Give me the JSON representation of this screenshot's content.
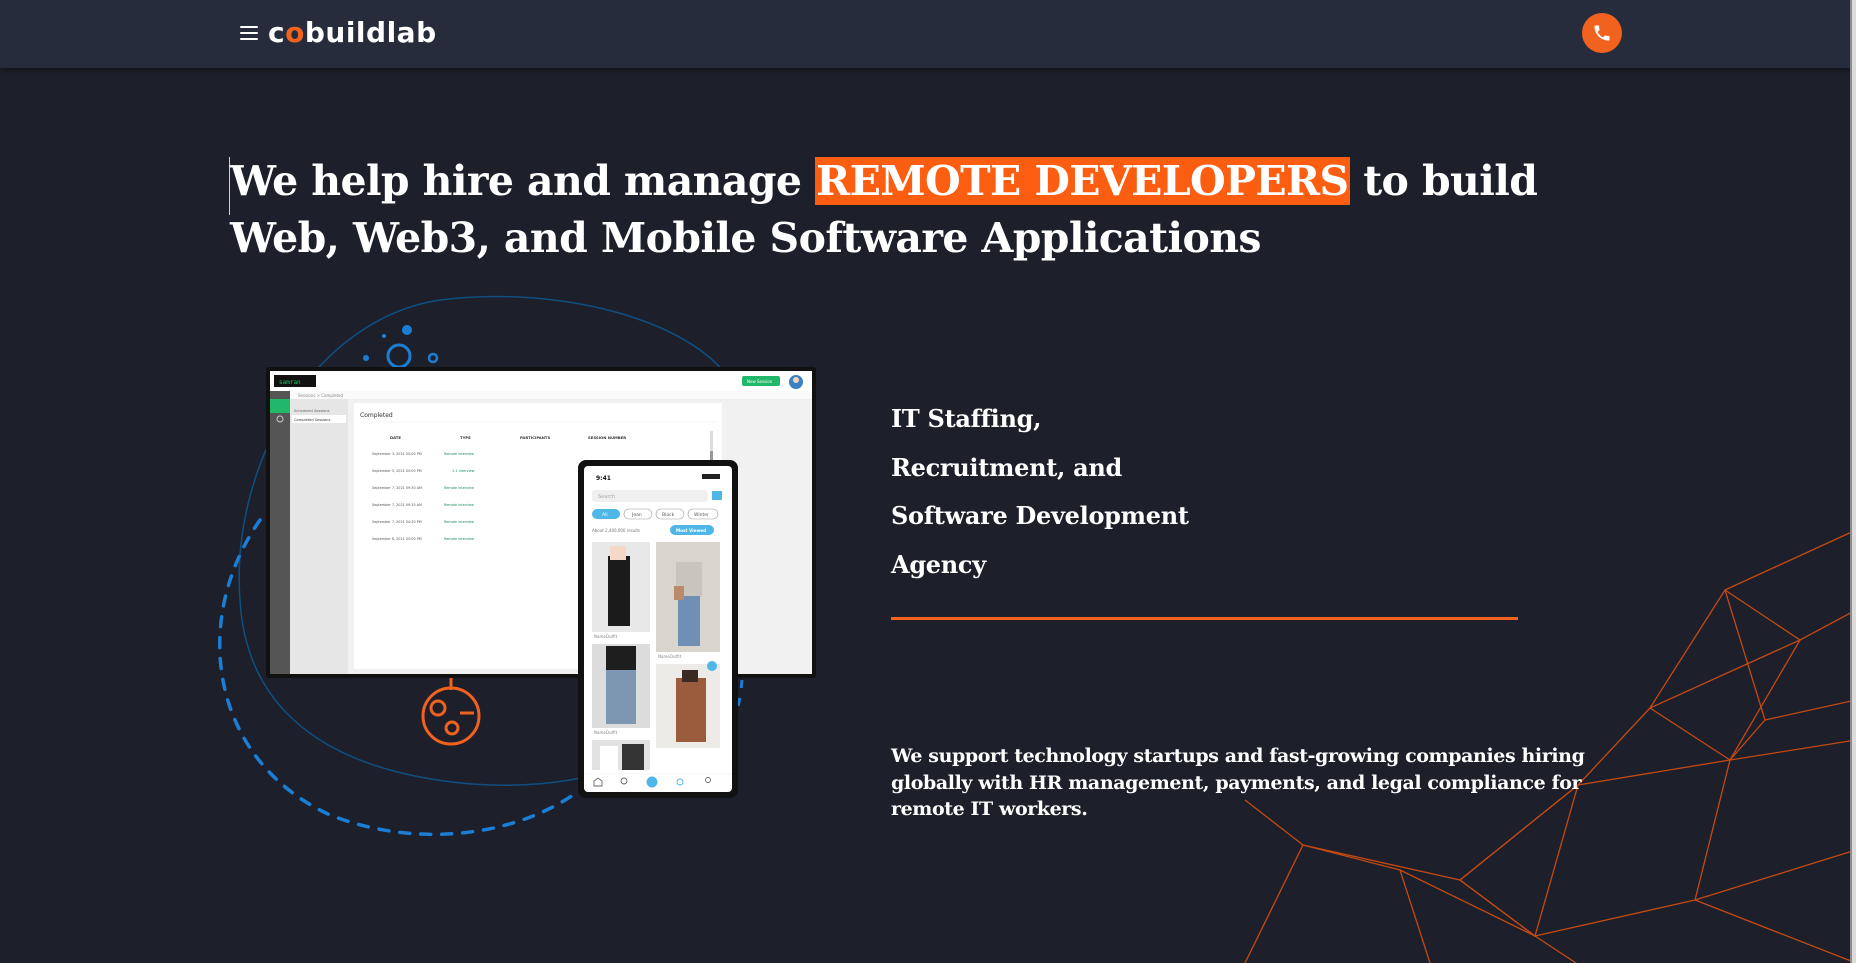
{
  "header": {
    "logo_text_a": "c",
    "logo_text_o": "o",
    "logo_text_b": "buildlab",
    "menu_icon": "hamburger-icon",
    "phone_icon": "phone-icon"
  },
  "hero": {
    "title_before": "We help hire and manage ",
    "title_highlight": "REMOTE DEVELOPERS",
    "title_after": " to build Web, Web3, and Mobile Software Applications"
  },
  "services": [
    "IT Staffing,",
    "Recruitment, and",
    "Software Development",
    "Agency"
  ],
  "description": "We support technology startups and fast-growing companies hiring globally with HR management, payments, and legal compliance for remote IT workers.",
  "mockup": {
    "desktop": {
      "brand": "samran",
      "new_session_button": "New Session",
      "breadcrumb": "Sessions > Completed",
      "sidebar_items": [
        "Scheduled Sessions",
        "Completed Sessions"
      ],
      "section_title": "Completed",
      "columns": [
        "DATE",
        "TYPE",
        "PARTICIPANTS",
        "SESSION NUMBER"
      ],
      "rows": [
        {
          "date": "September 3, 2021 05:00 PM",
          "type": "Remote interview"
        },
        {
          "date": "September 5, 2021 05:00 PM",
          "type": "1-1 Interview"
        },
        {
          "date": "September 7, 2021 09:30 AM",
          "type": "Remote interview"
        },
        {
          "date": "September 7, 2021 09:35 AM",
          "type": "Remote interview"
        },
        {
          "date": "September 7, 2021 04:30 PM",
          "type": "Remote interview"
        },
        {
          "date": "September 8, 2021 05:00 PM",
          "type": "Remote interview"
        }
      ]
    },
    "mobile": {
      "time": "9:41",
      "search_placeholder": "Search",
      "chips": [
        "All",
        "Jean",
        "Black",
        "Winter"
      ],
      "results": "About 2,400,000 results",
      "sort_button": "Most Viewed",
      "captions": [
        "NameOutfit",
        "NameOutfit",
        "NameOutfit"
      ]
    }
  },
  "colors": {
    "background": "#1d1f2b",
    "header": "#272c3c",
    "accent": "#f2621f",
    "highlight": "#fb5e11",
    "deco_blue": "#1a7fd4"
  }
}
